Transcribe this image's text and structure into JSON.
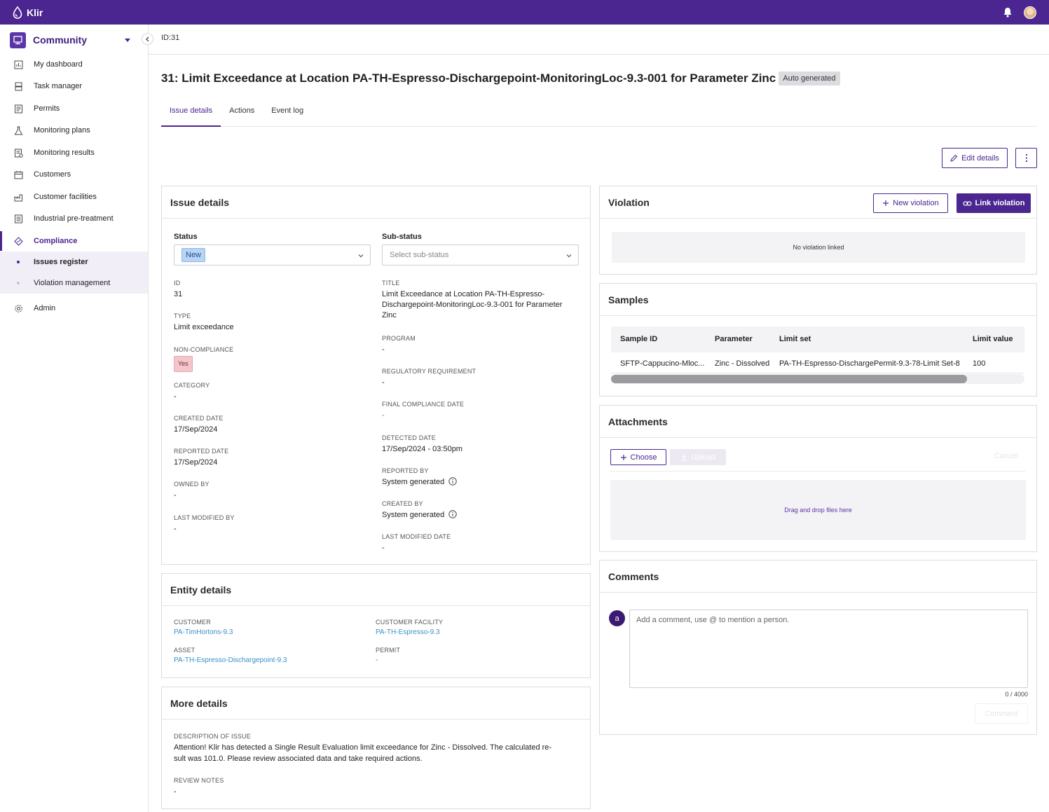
{
  "app": {
    "brand": "Klir"
  },
  "sidebar": {
    "community_label": "Community",
    "items": [
      {
        "label": "My dashboard",
        "icon": "chart-icon"
      },
      {
        "label": "Task manager",
        "icon": "task-icon"
      },
      {
        "label": "Permits",
        "icon": "document-icon"
      },
      {
        "label": "Monitoring plans",
        "icon": "flask-icon"
      },
      {
        "label": "Monitoring results",
        "icon": "results-icon"
      },
      {
        "label": "Customers",
        "icon": "calendar-icon"
      },
      {
        "label": "Customer facilities",
        "icon": "factory-icon"
      },
      {
        "label": "Industrial pre-treatment",
        "icon": "list-icon"
      },
      {
        "label": "Compliance",
        "icon": "compliance-icon"
      }
    ],
    "sub_items": [
      {
        "label": "Issues register"
      },
      {
        "label": "Violation management"
      }
    ],
    "admin_label": "Admin"
  },
  "header": {
    "id_label": "ID:31",
    "title": "31: Limit Exceedance at Location PA-TH-Espresso-Dischargepoint-MonitoringLoc-9.3-001 for Parameter Zinc",
    "badge": "Auto generated"
  },
  "tabs": [
    {
      "label": "Issue details"
    },
    {
      "label": "Actions"
    },
    {
      "label": "Event log"
    }
  ],
  "toolbar": {
    "edit_label": "Edit details"
  },
  "issue_details": {
    "heading": "Issue details",
    "status_label": "Status",
    "status_value": "New",
    "substatus_label": "Sub-status",
    "substatus_placeholder": "Select sub-status",
    "left_fields": [
      {
        "label": "ID",
        "value": "31"
      },
      {
        "label": "TYPE",
        "value": "Limit exceedance"
      },
      {
        "label": "NON-COMPLIANCE",
        "value": "Yes"
      },
      {
        "label": "CATEGORY",
        "value": "-"
      },
      {
        "label": "CREATED DATE",
        "value": "17/Sep/2024"
      },
      {
        "label": "REPORTED DATE",
        "value": "17/Sep/2024"
      },
      {
        "label": "OWNED BY",
        "value": "-"
      },
      {
        "label": "LAST MODIFIED BY",
        "value": "-"
      }
    ],
    "right_fields": [
      {
        "label": "TITLE",
        "value": "Limit Exceedance at Location PA-TH-Espresso-Dischargepoint-MonitoringLoc-9.3-001 for Parameter Zinc"
      },
      {
        "label": "PROGRAM",
        "value": "-"
      },
      {
        "label": "REGULATORY REQUIREMENT",
        "value": "-"
      },
      {
        "label": "FINAL COMPLIANCE DATE",
        "value": "-"
      },
      {
        "label": "DETECTED DATE",
        "value": "17/Sep/2024 - 03:50pm"
      },
      {
        "label": "REPORTED BY",
        "value": "System generated"
      },
      {
        "label": "CREATED BY",
        "value": "System generated"
      },
      {
        "label": "LAST MODIFIED DATE",
        "value": "-"
      }
    ]
  },
  "entity_details": {
    "heading": "Entity details",
    "fields": [
      {
        "label": "CUSTOMER",
        "value": "PA-TimHortons-9.3"
      },
      {
        "label": "CUSTOMER FACILITY",
        "value": "PA-TH-Espresso-9.3"
      },
      {
        "label": "ASSET",
        "value": "PA-TH-Espresso-Dischargepoint-9.3"
      },
      {
        "label": "PERMIT",
        "value": "-"
      }
    ]
  },
  "more_details": {
    "heading": "More details",
    "description_label": "DESCRIPTION OF ISSUE",
    "description_line1": "Attention! Klir has detected a Single Result Evaluation limit exceedance for Zinc - Dissolved. The calculated re-",
    "description_line2": "sult was 101.0. Please review associated data and take required actions.",
    "review_label": "REVIEW NOTES",
    "review_value": "-"
  },
  "violation": {
    "heading": "Violation",
    "new_label": "New violation",
    "link_label": "Link violation",
    "empty_text": "No violation linked"
  },
  "samples": {
    "heading": "Samples",
    "columns": [
      "Sample ID",
      "Parameter",
      "Limit set",
      "Limit value"
    ],
    "rows": [
      [
        "SFTP-Cappucino-Mloc...",
        "Zinc - Dissolved",
        "PA-TH-Espresso-DischargePermit-9.3-78-Limit Set-8",
        "100"
      ]
    ]
  },
  "attachments": {
    "heading": "Attachments",
    "choose_label": "Choose",
    "upload_label": "Upload",
    "cancel_label": "Cancel",
    "drop_text": "Drag and drop files here"
  },
  "comments": {
    "heading": "Comments",
    "avatar_letter": "a",
    "placeholder": "Add a comment, use @ to mention a person.",
    "counter": "0 / 4000",
    "submit_label": "Comment"
  },
  "colors": {
    "brand": "#4b2590",
    "link": "#3a8fc7",
    "status_new": "#b8d4f5",
    "noncompliance": "#f2c6cb"
  }
}
